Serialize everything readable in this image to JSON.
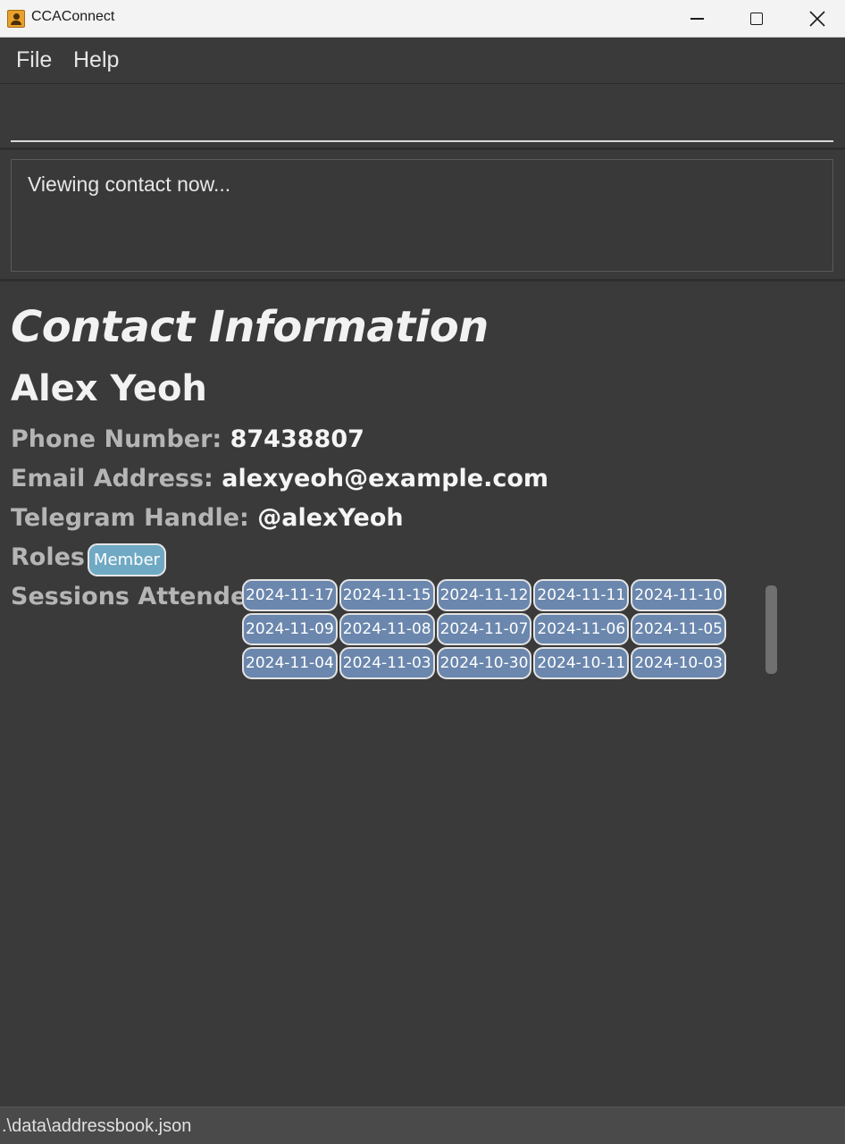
{
  "window": {
    "title": "CCAConnect"
  },
  "menu": {
    "file": "File",
    "help": "Help"
  },
  "command": {
    "value": ""
  },
  "result": {
    "text": "Viewing contact now..."
  },
  "contact": {
    "heading": "Contact Information",
    "name": "Alex Yeoh",
    "phone_label": "Phone Number: ",
    "phone": "87438807",
    "email_label": "Email Address: ",
    "email": "alexyeoh@example.com",
    "telegram_label": "Telegram Handle: ",
    "telegram": "@alexYeoh",
    "roles_label": "Roles:",
    "roles": [
      "Member"
    ],
    "sessions_label": "Sessions Attended:",
    "sessions": [
      [
        "2024-11-17",
        "2024-11-15",
        "2024-11-12",
        "2024-11-11",
        "2024-11-10"
      ],
      [
        "2024-11-09",
        "2024-11-08",
        "2024-11-07",
        "2024-11-06",
        "2024-11-05"
      ],
      [
        "2024-11-04",
        "2024-11-03",
        "2024-10-30",
        "2024-10-11",
        "2024-10-03"
      ]
    ]
  },
  "status": {
    "path": ".\\data\\addressbook.json"
  },
  "colors": {
    "background": "#3a3a3a",
    "role_badge": "#6fa9c4",
    "session_chip": "#6b87ad"
  }
}
